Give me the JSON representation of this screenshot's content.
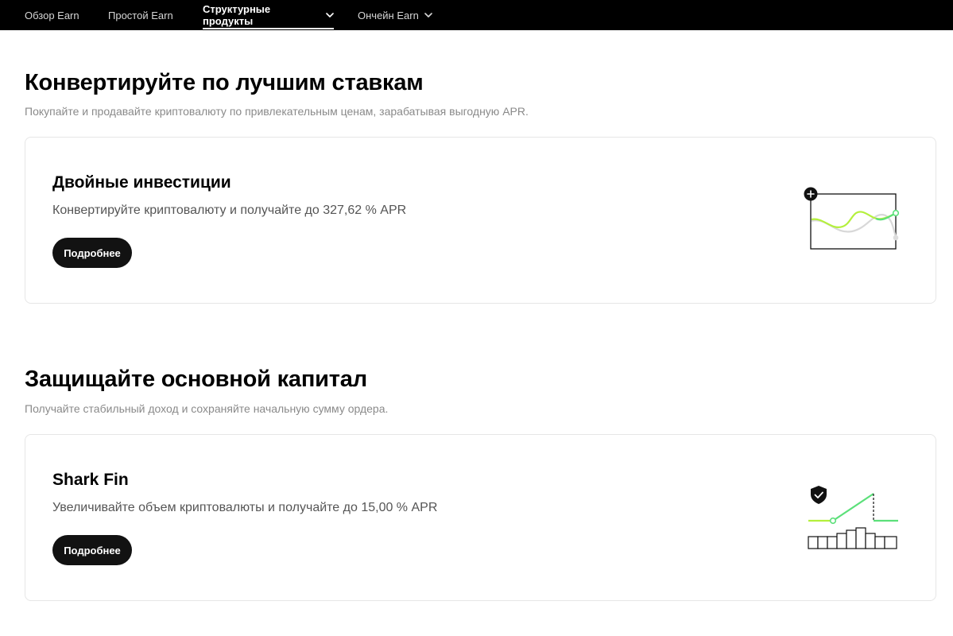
{
  "nav": {
    "items": [
      {
        "label": "Обзор Earn",
        "active": false,
        "has_dropdown": false
      },
      {
        "label": "Простой Earn",
        "active": false,
        "has_dropdown": false
      },
      {
        "label": "Структурные продукты",
        "active": true,
        "has_dropdown": true
      },
      {
        "label": "Ончейн Earn",
        "active": false,
        "has_dropdown": true
      }
    ]
  },
  "sections": [
    {
      "title": "Конвертируйте по лучшим ставкам",
      "subtitle": "Покупайте и продавайте криптовалюту по привлекательным ценам, зарабатывая выгодную APR.",
      "card": {
        "title": "Двойные инвестиции",
        "description": "Конвертируйте криптовалюту и получайте до 327,62 % APR",
        "button": "Подробнее",
        "illustration": "dual-investment-chart-icon"
      }
    },
    {
      "title": "Защищайте основной капитал",
      "subtitle": "Получайте стабильный доход и сохраняйте начальную сумму ордера.",
      "card": {
        "title": "Shark Fin",
        "description": "Увеличивайте объем криптовалюты и получайте до 15,00 % APR",
        "button": "Подробнее",
        "illustration": "shark-fin-chart-icon"
      }
    }
  ],
  "colors": {
    "nav_bg": "#000000",
    "accent_green": "#5ce07a",
    "accent_lime": "#b4f03c",
    "button_bg": "#121212"
  }
}
